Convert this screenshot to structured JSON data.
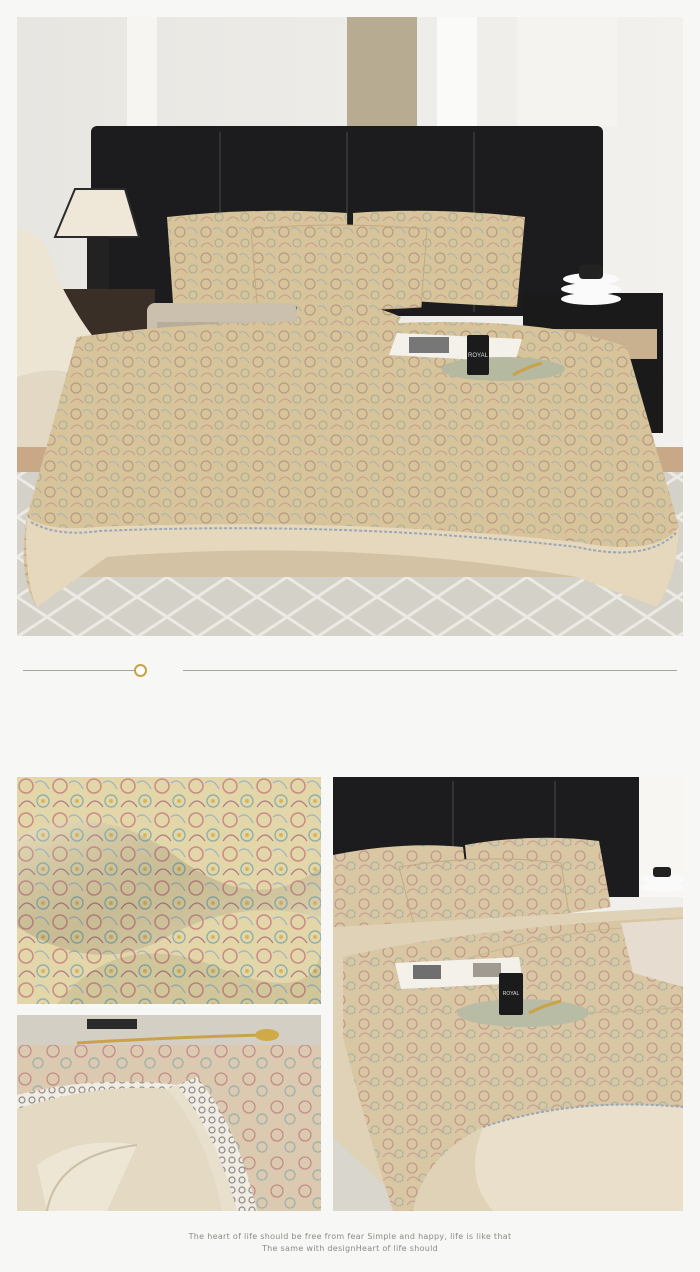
{
  "images": {
    "hero": "bedroom-bed-paisley-bedding-photo",
    "detail_top": "paisley-fabric-closeup-photo",
    "detail_bottom": "satin-border-lace-trim-closeup-photo",
    "side_view": "bed-side-angle-photo"
  },
  "magazine_text": "ROYAL",
  "caption": {
    "line1": "The heart of life should be free from fear Simple and happy, life is like that",
    "line2": "The same with designHeart of life should"
  },
  "colors": {
    "page_background": "#f7f7f5",
    "accent_gold": "#c7a24a",
    "divider": "#a9a49b",
    "caption_text": "#8d8a84"
  }
}
